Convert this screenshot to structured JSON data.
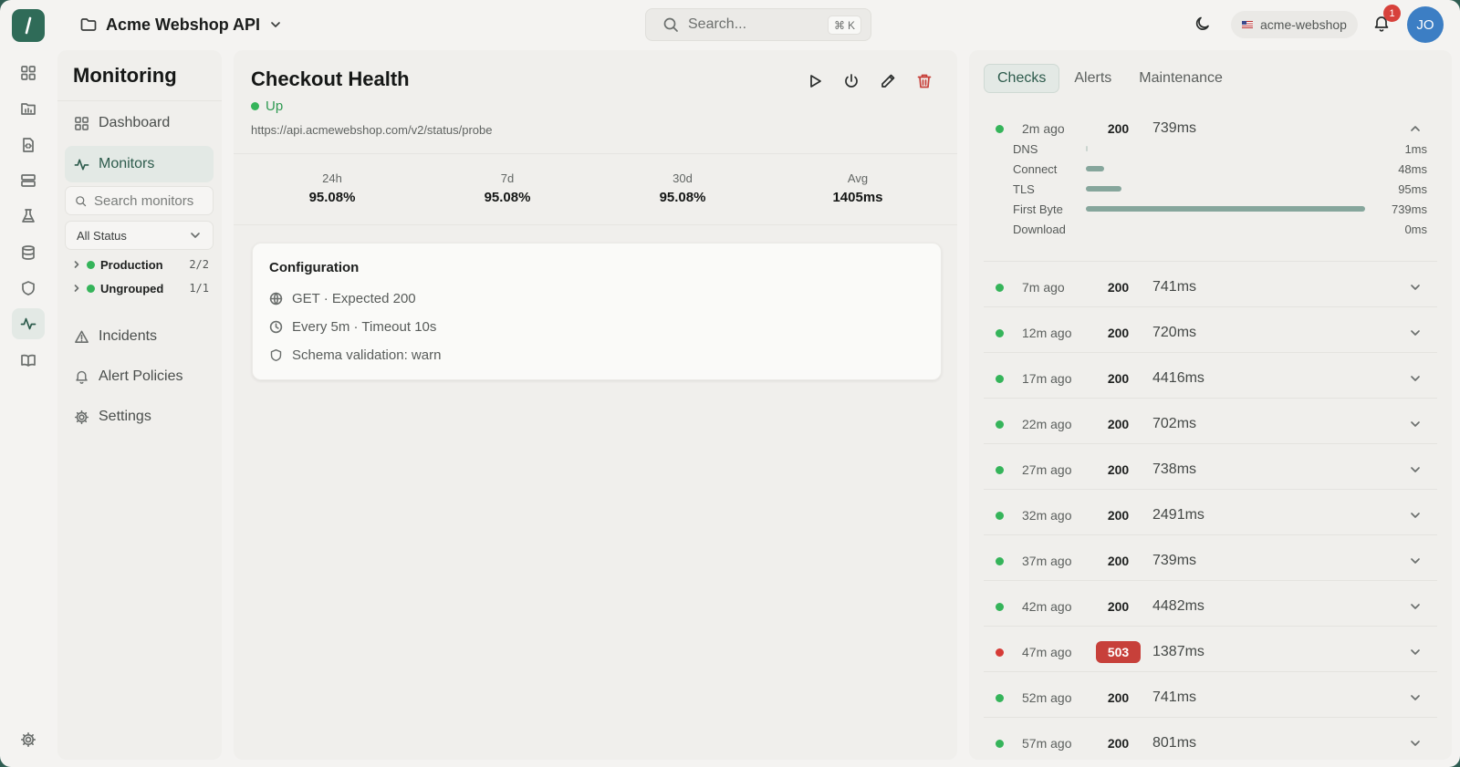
{
  "app": {
    "project_name": "Acme Webshop API",
    "search_placeholder": "Search...",
    "search_shortcut": "K",
    "tenant": "acme-webshop",
    "notifications_count": "1",
    "user_initials": "JO"
  },
  "colors": {
    "brand": "#2f6b58",
    "up": "#35b45a",
    "down": "#d63b36",
    "active_bg": "#e3e9e5"
  },
  "rail": [
    "grid-icon",
    "folder-chart-icon",
    "file-code-icon",
    "server-icon",
    "flask-icon",
    "database-icon",
    "shield-icon",
    "activity-icon",
    "book-icon",
    "gear-icon"
  ],
  "sidebar": {
    "title": "Monitoring",
    "dashboard": "Dashboard",
    "monitors": "Monitors",
    "search_placeholder": "Search monitors",
    "status_filter": "All Status",
    "groups": [
      {
        "name": "Production",
        "count": "2/2"
      },
      {
        "name": "Ungrouped",
        "count": "1/1"
      }
    ],
    "incidents": "Incidents",
    "alert_policies": "Alert Policies",
    "settings": "Settings"
  },
  "monitor": {
    "title": "Checkout Health",
    "status": "Up",
    "url": "https://api.acmewebshop.com/v2/status/probe",
    "stats": [
      {
        "label": "24h",
        "value": "95.08%"
      },
      {
        "label": "7d",
        "value": "95.08%"
      },
      {
        "label": "30d",
        "value": "95.08%"
      },
      {
        "label": "Avg",
        "value": "1405ms"
      }
    ],
    "config": {
      "title": "Configuration",
      "method": "GET · Expected 200",
      "interval": "Every 5m · Timeout 10s",
      "schema": "Schema validation: warn"
    }
  },
  "checks_panel": {
    "tabs": [
      "Checks",
      "Alerts",
      "Maintenance"
    ],
    "active_tab": "Checks",
    "timing": [
      {
        "label": "DNS",
        "ms": 1,
        "text": "1ms"
      },
      {
        "label": "Connect",
        "ms": 48,
        "text": "48ms"
      },
      {
        "label": "TLS",
        "ms": 95,
        "text": "95ms"
      },
      {
        "label": "First Byte",
        "ms": 739,
        "text": "739ms"
      },
      {
        "label": "Download",
        "ms": 0,
        "text": "0ms"
      }
    ],
    "checks": [
      {
        "ago": "2m ago",
        "code": "200",
        "ms": "739ms",
        "ok": true,
        "expanded": true
      },
      {
        "ago": "7m ago",
        "code": "200",
        "ms": "741ms",
        "ok": true
      },
      {
        "ago": "12m ago",
        "code": "200",
        "ms": "720ms",
        "ok": true
      },
      {
        "ago": "17m ago",
        "code": "200",
        "ms": "4416ms",
        "ok": true
      },
      {
        "ago": "22m ago",
        "code": "200",
        "ms": "702ms",
        "ok": true
      },
      {
        "ago": "27m ago",
        "code": "200",
        "ms": "738ms",
        "ok": true
      },
      {
        "ago": "32m ago",
        "code": "200",
        "ms": "2491ms",
        "ok": true
      },
      {
        "ago": "37m ago",
        "code": "200",
        "ms": "739ms",
        "ok": true
      },
      {
        "ago": "42m ago",
        "code": "200",
        "ms": "4482ms",
        "ok": true
      },
      {
        "ago": "47m ago",
        "code": "503",
        "ms": "1387ms",
        "ok": false
      },
      {
        "ago": "52m ago",
        "code": "200",
        "ms": "741ms",
        "ok": true
      },
      {
        "ago": "57m ago",
        "code": "200",
        "ms": "801ms",
        "ok": true
      }
    ]
  }
}
